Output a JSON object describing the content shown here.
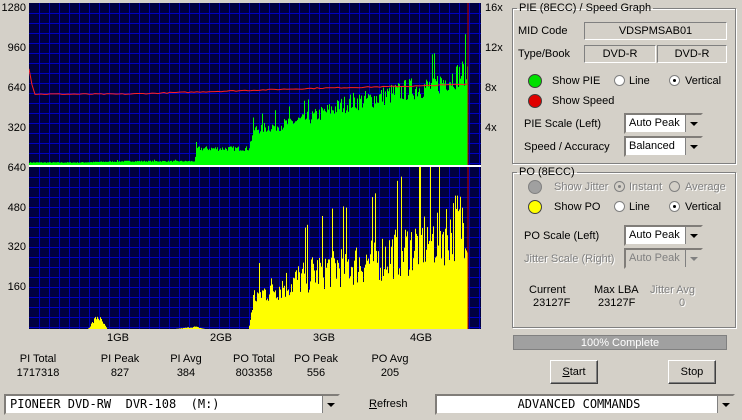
{
  "chart_data": [
    {
      "type": "area",
      "title": "",
      "series": [
        {
          "name": "PIE",
          "color": "#00ff00",
          "x": [
            0,
            0.3,
            0.5,
            1.0,
            1.5,
            1.7,
            1.71,
            2.0,
            2.25,
            2.3,
            2.6,
            2.9,
            3.1,
            3.3,
            3.5,
            3.7,
            3.9,
            4.1,
            4.3,
            4.5
          ],
          "y": [
            20,
            20,
            20,
            30,
            30,
            30,
            130,
            130,
            130,
            280,
            320,
            380,
            440,
            500,
            520,
            560,
            600,
            620,
            680,
            750
          ]
        },
        {
          "name": "Speed",
          "color": "#ff0000",
          "axis": "right",
          "x": [
            0,
            0.05,
            0.1,
            1.0,
            2.0,
            3.0,
            4.0,
            4.5
          ],
          "y": [
            9.5,
            7.0,
            7.0,
            7.0,
            7.3,
            7.6,
            7.8,
            8.0
          ]
        }
      ],
      "ylim": [
        0,
        1280
      ],
      "yticks": [
        "1280",
        "960",
        "640",
        "320"
      ],
      "y2lim": [
        0,
        16
      ],
      "y2ticks": [
        "16x",
        "12x",
        "8x",
        "4x"
      ],
      "xlim": [
        0,
        4.5
      ],
      "grid": true,
      "background": "#000040",
      "grid_color": "#0000c0"
    },
    {
      "type": "area",
      "title": "",
      "series": [
        {
          "name": "PO",
          "color": "#ffff00",
          "x": [
            0,
            0.6,
            0.7,
            0.8,
            0.9,
            1.5,
            1.7,
            1.8,
            2.0,
            2.25,
            2.3,
            2.5,
            2.7,
            2.9,
            3.1,
            3.3,
            3.5,
            3.7,
            3.9,
            4.1,
            4.3,
            4.5
          ],
          "y": [
            0,
            0,
            60,
            0,
            0,
            0,
            10,
            0,
            0,
            0,
            150,
            190,
            220,
            260,
            290,
            300,
            320,
            350,
            380,
            420,
            460,
            520
          ]
        }
      ],
      "ylim": [
        0,
        640
      ],
      "yticks": [
        "640",
        "480",
        "320",
        "160"
      ],
      "xticks": [
        "1GB",
        "2GB",
        "3GB",
        "4GB"
      ],
      "xlim": [
        0,
        4.5
      ],
      "grid": true,
      "background": "#000040",
      "grid_color": "#0000c0"
    }
  ],
  "stats": {
    "pi_total_label": "PI Total",
    "pi_total": "1717318",
    "pi_peak_label": "PI Peak",
    "pi_peak": "827",
    "pi_avg_label": "PI Avg",
    "pi_avg": "384",
    "po_total_label": "PO Total",
    "po_total": "803358",
    "po_peak_label": "PO Peak",
    "po_peak": "556",
    "po_avg_label": "PO Avg",
    "po_avg": "205"
  },
  "pie_panel": {
    "title": "PIE (8ECC) / Speed Graph",
    "mid_code_label": "MID Code",
    "mid_code": "VDSPMSAB01",
    "type_book_label": "Type/Book",
    "type": "DVD-R",
    "book": "DVD-R",
    "show_pie_label": "Show PIE",
    "show_speed_label": "Show Speed",
    "line_label": "Line",
    "vertical_label": "Vertical",
    "scale_label": "PIE Scale (Left)",
    "scale_value": "Auto Peak",
    "speed_label": "Speed / Accuracy",
    "speed_value": "Balanced",
    "pie_color": "#00e000",
    "speed_color": "#e00000"
  },
  "po_panel": {
    "title": "PO (8ECC)",
    "show_jitter_label": "Show Jitter",
    "instant_label": "Instant",
    "average_label": "Average",
    "show_po_label": "Show PO",
    "line_label": "Line",
    "vertical_label": "Vertical",
    "scale_label": "PO Scale (Left)",
    "scale_value": "Auto Peak",
    "jitter_scale_label": "Jitter Scale (Right)",
    "jitter_scale_value": "Auto Peak",
    "current_label": "Current",
    "current_value": "23127F",
    "max_lba_label": "Max LBA",
    "max_lba_value": "23127F",
    "jitter_avg_label": "Jitter Avg",
    "jitter_avg_value": "0",
    "po_color": "#ffff00"
  },
  "progress": {
    "text": "100% Complete",
    "value": 100
  },
  "buttons": {
    "start_first": "S",
    "start_rest": "tart",
    "stop": "Stop"
  },
  "bottom": {
    "drive": "PIONEER DVD-RW  DVR-108  (M:)",
    "refresh_first": "R",
    "refresh_rest": "efresh",
    "advanced": "ADVANCED COMMANDS"
  }
}
